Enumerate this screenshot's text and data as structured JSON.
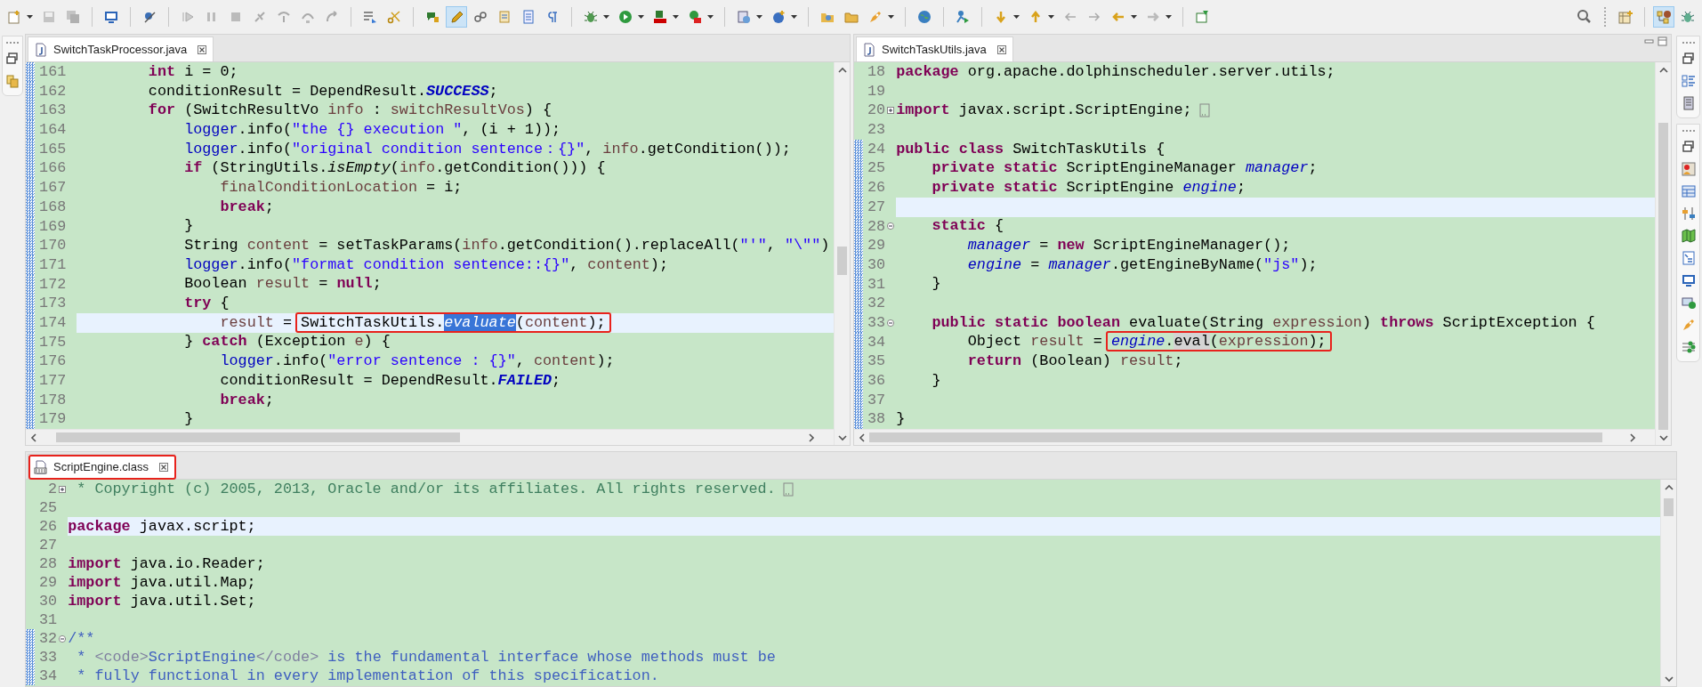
{
  "editors": [
    {
      "tab": {
        "label": "SwitchTaskProcessor.java",
        "selected": true
      },
      "lines": [
        {
          "number": "161",
          "changed": true,
          "current": false,
          "tokens": [
            {
              "kind": "kw",
              "text": "        int"
            },
            {
              "kind": "plain",
              "text": " i = 0;"
            }
          ]
        },
        {
          "number": "162",
          "changed": true,
          "current": false,
          "tokens": [
            {
              "kind": "plain",
              "text": "        conditionResult = DependResult."
            },
            {
              "kind": "constant",
              "text": "SUCCESS"
            },
            {
              "kind": "plain",
              "text": ";"
            }
          ]
        },
        {
          "number": "163",
          "changed": true,
          "current": false,
          "tokens": [
            {
              "kind": "kw",
              "text": "        for"
            },
            {
              "kind": "plain",
              "text": " (SwitchResultVo "
            },
            {
              "kind": "local",
              "text": "info"
            },
            {
              "kind": "plain",
              "text": " : "
            },
            {
              "kind": "local",
              "text": "switchResultVos"
            },
            {
              "kind": "plain",
              "text": ") {"
            }
          ]
        },
        {
          "number": "164",
          "changed": true,
          "current": false,
          "tokens": [
            {
              "kind": "field",
              "text": "            logger"
            },
            {
              "kind": "plain",
              "text": ".info("
            },
            {
              "kind": "string",
              "text": "\"the {} execution \""
            },
            {
              "kind": "plain",
              "text": ", (i + 1));"
            }
          ]
        },
        {
          "number": "165",
          "changed": true,
          "current": false,
          "tokens": [
            {
              "kind": "field",
              "text": "            logger"
            },
            {
              "kind": "plain",
              "text": ".info("
            },
            {
              "kind": "string",
              "text": "\"original condition sentence：{}\""
            },
            {
              "kind": "plain",
              "text": ", "
            },
            {
              "kind": "local",
              "text": "info"
            },
            {
              "kind": "plain",
              "text": ".getCondition());"
            }
          ]
        },
        {
          "number": "166",
          "changed": true,
          "current": false,
          "tokens": [
            {
              "kind": "kw",
              "text": "            if"
            },
            {
              "kind": "plain",
              "text": " (StringUtils."
            },
            {
              "kind": "static-method",
              "text": "isEmpty"
            },
            {
              "kind": "plain",
              "text": "("
            },
            {
              "kind": "local",
              "text": "info"
            },
            {
              "kind": "plain",
              "text": ".getCondition())) {"
            }
          ]
        },
        {
          "number": "167",
          "changed": true,
          "current": false,
          "tokens": [
            {
              "kind": "local",
              "text": "                finalConditionLocation"
            },
            {
              "kind": "plain",
              "text": " = i;"
            }
          ]
        },
        {
          "number": "168",
          "changed": true,
          "current": false,
          "tokens": [
            {
              "kind": "kw",
              "text": "                break"
            },
            {
              "kind": "plain",
              "text": ";"
            }
          ]
        },
        {
          "number": "169",
          "changed": true,
          "current": false,
          "tokens": [
            {
              "kind": "plain",
              "text": "            }"
            }
          ]
        },
        {
          "number": "170",
          "changed": true,
          "current": false,
          "tokens": [
            {
              "kind": "plain",
              "text": "            String "
            },
            {
              "kind": "local",
              "text": "content"
            },
            {
              "kind": "plain",
              "text": " = setTaskParams("
            },
            {
              "kind": "local",
              "text": "info"
            },
            {
              "kind": "plain",
              "text": ".getCondition().replaceAll("
            },
            {
              "kind": "string",
              "text": "\"'\""
            },
            {
              "kind": "plain",
              "text": ", "
            },
            {
              "kind": "string",
              "text": "\"\\\"\""
            },
            {
              "kind": "plain",
              "text": ")"
            }
          ]
        },
        {
          "number": "171",
          "changed": true,
          "current": false,
          "tokens": [
            {
              "kind": "field",
              "text": "            logger"
            },
            {
              "kind": "plain",
              "text": ".info("
            },
            {
              "kind": "string",
              "text": "\"format condition sentence::{}\""
            },
            {
              "kind": "plain",
              "text": ", "
            },
            {
              "kind": "local",
              "text": "content"
            },
            {
              "kind": "plain",
              "text": ");"
            }
          ]
        },
        {
          "number": "172",
          "changed": true,
          "current": false,
          "tokens": [
            {
              "kind": "plain",
              "text": "            Boolean "
            },
            {
              "kind": "local",
              "text": "result"
            },
            {
              "kind": "plain",
              "text": " = "
            },
            {
              "kind": "kw",
              "text": "null"
            },
            {
              "kind": "plain",
              "text": ";"
            }
          ]
        },
        {
          "number": "173",
          "changed": true,
          "current": false,
          "tokens": [
            {
              "kind": "kw",
              "text": "            try"
            },
            {
              "kind": "plain",
              "text": " {"
            }
          ]
        },
        {
          "number": "174",
          "changed": true,
          "current": true,
          "tokens": [
            {
              "kind": "local",
              "text": "                result"
            },
            {
              "kind": "plain",
              "text": " = "
            },
            {
              "kind": "boxed",
              "tokens": [
                {
                  "kind": "plain",
                  "text": "SwitchTaskUtils."
                },
                {
                  "kind": "static-method",
                  "text": "evaluate",
                  "selected": true
                },
                {
                  "kind": "plain",
                  "text": "("
                },
                {
                  "kind": "local",
                  "text": "content"
                },
                {
                  "kind": "plain",
                  "text": ");"
                }
              ]
            }
          ]
        },
        {
          "number": "175",
          "changed": true,
          "current": false,
          "tokens": [
            {
              "kind": "plain",
              "text": "            } "
            },
            {
              "kind": "kw",
              "text": "catch"
            },
            {
              "kind": "plain",
              "text": " (Exception "
            },
            {
              "kind": "local",
              "text": "e"
            },
            {
              "kind": "plain",
              "text": ") {"
            }
          ]
        },
        {
          "number": "176",
          "changed": true,
          "current": false,
          "tokens": [
            {
              "kind": "field",
              "text": "                logger"
            },
            {
              "kind": "plain",
              "text": ".info("
            },
            {
              "kind": "string",
              "text": "\"error sentence : {}\""
            },
            {
              "kind": "plain",
              "text": ", "
            },
            {
              "kind": "local",
              "text": "content"
            },
            {
              "kind": "plain",
              "text": ");"
            }
          ]
        },
        {
          "number": "177",
          "changed": true,
          "current": false,
          "tokens": [
            {
              "kind": "plain",
              "text": "                conditionResult = DependResult."
            },
            {
              "kind": "constant",
              "text": "FAILED"
            },
            {
              "kind": "plain",
              "text": ";"
            }
          ]
        },
        {
          "number": "178",
          "changed": true,
          "current": false,
          "tokens": [
            {
              "kind": "kw",
              "text": "                break"
            },
            {
              "kind": "plain",
              "text": ";"
            }
          ]
        },
        {
          "number": "179",
          "changed": true,
          "current": false,
          "tokens": [
            {
              "kind": "plain",
              "text": "            }"
            }
          ]
        }
      ]
    },
    {
      "tab": {
        "label": "SwitchTaskUtils.java",
        "selected": true
      },
      "lines": [
        {
          "number": "18",
          "changed": false,
          "current": false,
          "tokens": [
            {
              "kind": "kw",
              "text": "package"
            },
            {
              "kind": "plain",
              "text": " org.apache.dolphinscheduler.server.utils;"
            }
          ]
        },
        {
          "number": "19",
          "changed": false,
          "current": false
        },
        {
          "number": "20",
          "changed": false,
          "current": false,
          "collapsed": true,
          "tokens": [
            {
              "kind": "kw",
              "text": "import"
            },
            {
              "kind": "plain",
              "text": " javax.script.ScriptEngine;"
            }
          ]
        },
        {
          "number": "23",
          "changed": false,
          "current": false
        },
        {
          "number": "24",
          "changed": true,
          "current": false,
          "tokens": [
            {
              "kind": "kw",
              "text": "public"
            },
            {
              "kind": "kw",
              "text": " class"
            },
            {
              "kind": "plain",
              "text": " SwitchTaskUtils {"
            }
          ]
        },
        {
          "number": "25",
          "changed": true,
          "current": false,
          "tokens": [
            {
              "kind": "kw",
              "text": "    private"
            },
            {
              "kind": "kw",
              "text": " static"
            },
            {
              "kind": "plain",
              "text": " ScriptEngineManager "
            },
            {
              "kind": "static-field",
              "text": "manager"
            },
            {
              "kind": "plain",
              "text": ";"
            }
          ]
        },
        {
          "number": "26",
          "changed": true,
          "current": false,
          "tokens": [
            {
              "kind": "kw",
              "text": "    private"
            },
            {
              "kind": "kw",
              "text": " static"
            },
            {
              "kind": "plain",
              "text": " ScriptEngine "
            },
            {
              "kind": "static-field",
              "text": "engine"
            },
            {
              "kind": "plain",
              "text": ";"
            }
          ]
        },
        {
          "number": "27",
          "changed": true,
          "current": true
        },
        {
          "number": "28",
          "changed": true,
          "current": false,
          "collapsed": false,
          "tokens": [
            {
              "kind": "kw",
              "text": "    static"
            },
            {
              "kind": "plain",
              "text": " {"
            }
          ]
        },
        {
          "number": "29",
          "changed": true,
          "current": false,
          "tokens": [
            {
              "kind": "static-field",
              "text": "        manager"
            },
            {
              "kind": "plain",
              "text": " = "
            },
            {
              "kind": "kw",
              "text": "new"
            },
            {
              "kind": "plain",
              "text": " ScriptEngineManager();"
            }
          ]
        },
        {
          "number": "30",
          "changed": true,
          "current": false,
          "tokens": [
            {
              "kind": "static-field",
              "text": "        engine"
            },
            {
              "kind": "plain",
              "text": " = "
            },
            {
              "kind": "static-field",
              "text": "manager"
            },
            {
              "kind": "plain",
              "text": ".getEngineByName("
            },
            {
              "kind": "string",
              "text": "\"js\""
            },
            {
              "kind": "plain",
              "text": ");"
            }
          ]
        },
        {
          "number": "31",
          "changed": true,
          "current": false,
          "tokens": [
            {
              "kind": "plain",
              "text": "    }"
            }
          ]
        },
        {
          "number": "32",
          "changed": true,
          "current": false
        },
        {
          "number": "33",
          "changed": true,
          "current": false,
          "collapsed": false,
          "tokens": [
            {
              "kind": "kw",
              "text": "    public"
            },
            {
              "kind": "kw",
              "text": " static"
            },
            {
              "kind": "kw",
              "text": " boolean"
            },
            {
              "kind": "plain",
              "text": " evaluate(String "
            },
            {
              "kind": "local",
              "text": "expression"
            },
            {
              "kind": "plain",
              "text": ") "
            },
            {
              "kind": "kw",
              "text": "throws"
            },
            {
              "kind": "plain",
              "text": " ScriptException {"
            }
          ]
        },
        {
          "number": "34",
          "changed": true,
          "current": false,
          "tokens": [
            {
              "kind": "plain",
              "text": "        Object "
            },
            {
              "kind": "local",
              "text": "result"
            },
            {
              "kind": "plain",
              "text": " = "
            },
            {
              "kind": "boxed",
              "tokens": [
                {
                  "kind": "static-field",
                  "text": "engine"
                },
                {
                  "kind": "plain",
                  "text": "."
                },
                {
                  "kind": "plain",
                  "text": "eval",
                  "occurrence": true
                },
                {
                  "kind": "plain",
                  "text": "("
                },
                {
                  "kind": "local",
                  "text": "expression"
                },
                {
                  "kind": "plain",
                  "text": ");"
                }
              ]
            }
          ]
        },
        {
          "number": "35",
          "changed": true,
          "current": false,
          "tokens": [
            {
              "kind": "kw",
              "text": "        return"
            },
            {
              "kind": "plain",
              "text": " (Boolean) "
            },
            {
              "kind": "local",
              "text": "result"
            },
            {
              "kind": "plain",
              "text": ";"
            }
          ]
        },
        {
          "number": "36",
          "changed": true,
          "current": false,
          "tokens": [
            {
              "kind": "plain",
              "text": "    }"
            }
          ]
        },
        {
          "number": "37",
          "changed": true,
          "current": false
        },
        {
          "number": "38",
          "changed": true,
          "current": false,
          "tokens": [
            {
              "kind": "plain",
              "text": "}"
            }
          ]
        }
      ]
    },
    {
      "tab": {
        "label": "ScriptEngine.class",
        "selected": true,
        "boxed": true
      },
      "lines": [
        {
          "number": "2",
          "changed": false,
          "current": false,
          "collapsed": true,
          "tokens": [
            {
              "kind": "comment",
              "text": " * Copyright (c) 2005, 2013, Oracle and/or its affiliates. All rights reserved."
            }
          ]
        },
        {
          "number": "25",
          "changed": false,
          "current": false
        },
        {
          "number": "26",
          "changed": false,
          "current": true,
          "tokens": [
            {
              "kind": "kw",
              "text": "package"
            },
            {
              "kind": "plain",
              "text": " javax.script;"
            }
          ]
        },
        {
          "number": "27",
          "changed": false,
          "current": false
        },
        {
          "number": "28",
          "changed": false,
          "current": false,
          "tokens": [
            {
              "kind": "kw",
              "text": "import"
            },
            {
              "kind": "plain",
              "text": " java.io.Reader;"
            }
          ]
        },
        {
          "number": "29",
          "changed": false,
          "current": false,
          "tokens": [
            {
              "kind": "kw",
              "text": "import"
            },
            {
              "kind": "plain",
              "text": " java.util.Map;"
            }
          ]
        },
        {
          "number": "30",
          "changed": false,
          "current": false,
          "tokens": [
            {
              "kind": "kw",
              "text": "import"
            },
            {
              "kind": "plain",
              "text": " java.util.Set;"
            }
          ]
        },
        {
          "number": "31",
          "changed": false,
          "current": false
        },
        {
          "number": "32",
          "changed": true,
          "current": false,
          "collapsed": false,
          "tokens": [
            {
              "kind": "javadoc",
              "text": "/**"
            }
          ]
        },
        {
          "number": "33",
          "changed": true,
          "current": false,
          "tokens": [
            {
              "kind": "javadoc",
              "text": " * "
            },
            {
              "kind": "javadoc-tag",
              "text": "<code>"
            },
            {
              "kind": "javadoc",
              "text": "ScriptEngine"
            },
            {
              "kind": "javadoc-tag",
              "text": "</code>"
            },
            {
              "kind": "javadoc",
              "text": " is the fundamental interface whose methods must be"
            }
          ]
        },
        {
          "number": "34",
          "changed": true,
          "current": false,
          "tokens": [
            {
              "kind": "javadoc",
              "text": " * fully functional in every implementation of this specification."
            }
          ]
        }
      ]
    }
  ]
}
